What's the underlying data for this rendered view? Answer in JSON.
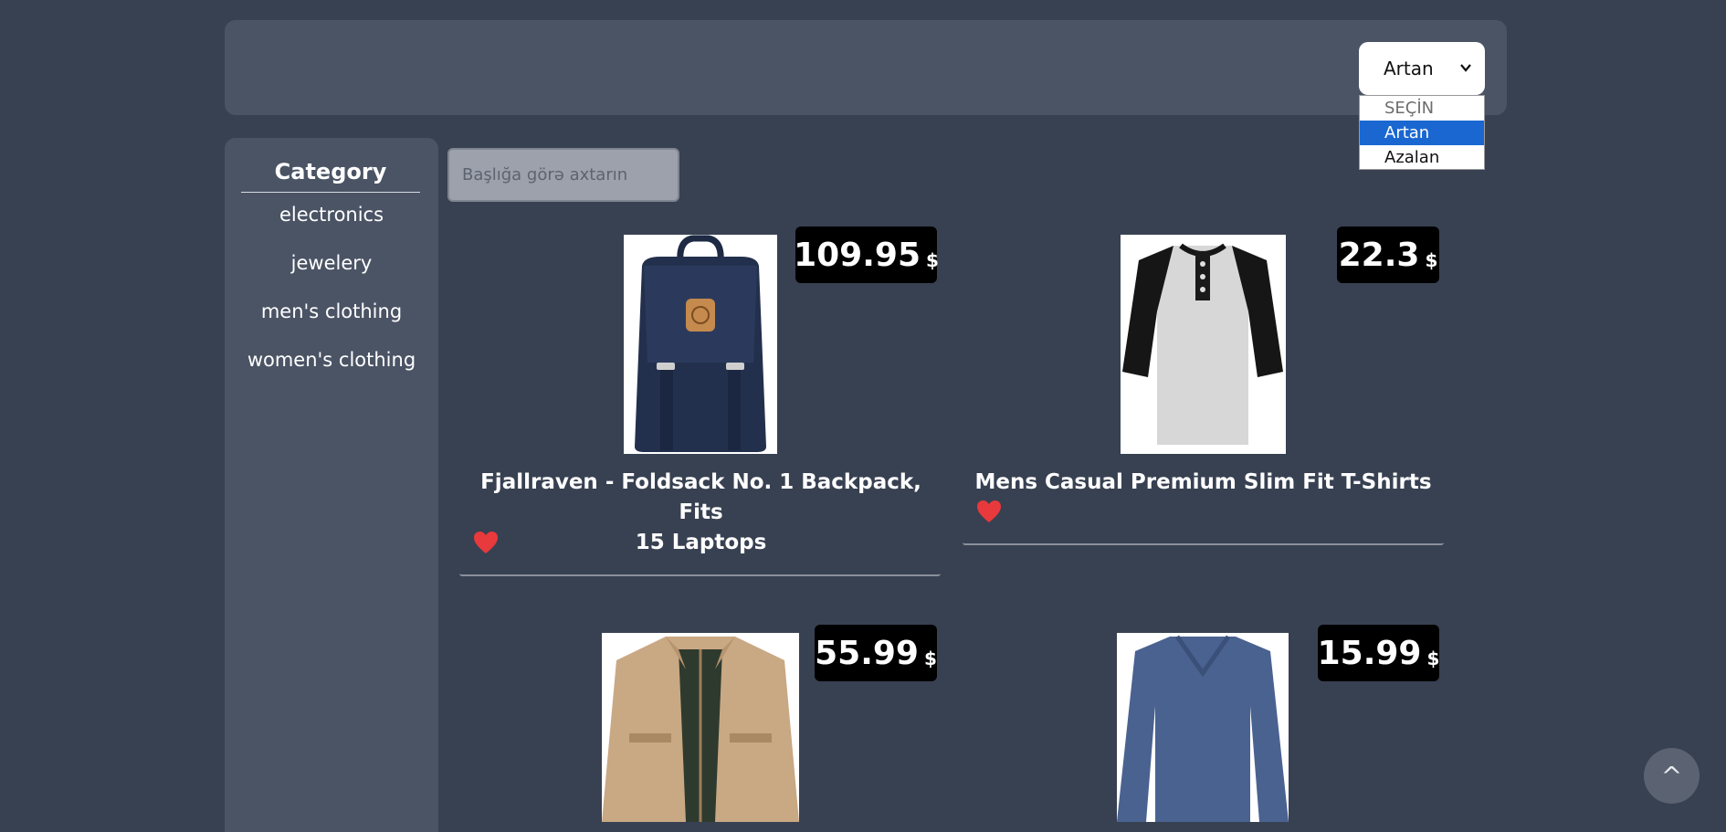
{
  "header": {
    "sort": {
      "selected": "Artan",
      "options": [
        "SEÇİN",
        "Artan",
        "Azalan"
      ]
    }
  },
  "sidebar": {
    "title": "Category",
    "categories": [
      "electronics",
      "jewelery",
      "men's clothing",
      "women's clothing"
    ]
  },
  "search": {
    "placeholder": "Başlığa görə axtarın"
  },
  "products": [
    {
      "title": "Fjallraven - Foldsack No. 1 Backpack, Fits 15 Laptops",
      "title_line1": "Fjallraven - Foldsack No. 1 Backpack, Fits",
      "title_line2": "15 Laptops",
      "price": "109.95",
      "currency": "$",
      "favorite": true
    },
    {
      "title": "Mens Casual Premium Slim Fit T-Shirts",
      "price": "22.3",
      "currency": "$",
      "favorite": true
    },
    {
      "price": "55.99",
      "currency": "$"
    },
    {
      "price": "15.99",
      "currency": "$"
    }
  ],
  "scroll_top": {
    "label": "^"
  },
  "colors": {
    "background": "#384152",
    "panel": "#4b5465",
    "price_badge": "#000000",
    "heart": "#e8393c",
    "selected_option": "#1a67d2"
  }
}
